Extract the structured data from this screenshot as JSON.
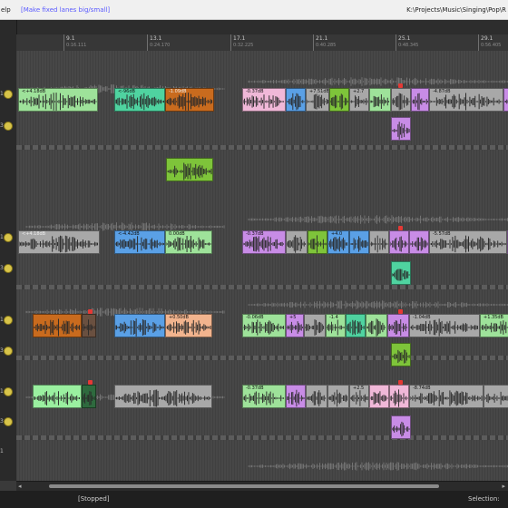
{
  "menubar": {
    "help": "elp",
    "hint": "[Make fixed lanes big/small]",
    "path": "K:\\Projects\\Music\\Singing\\Pop\\R"
  },
  "ruler": {
    "markers": [
      {
        "bar": "9.1",
        "time": "0:16.111"
      },
      {
        "bar": "13.1",
        "time": "0:24.170"
      },
      {
        "bar": "17.1",
        "time": "0:32.225"
      },
      {
        "bar": "21.1",
        "time": "0:40.285"
      },
      {
        "bar": "25.1",
        "time": "0:48.345"
      },
      {
        "bar": "29.1",
        "time": "0:56.405"
      }
    ]
  },
  "lanes": [
    {
      "num": "1",
      "has_dot": true
    },
    {
      "num": "3",
      "has_dot": true
    },
    {
      "num": "",
      "has_dot": false
    },
    {
      "num": "1",
      "has_dot": true
    },
    {
      "num": "3",
      "has_dot": true
    },
    {
      "num": "1",
      "has_dot": true
    },
    {
      "num": "3",
      "has_dot": true
    },
    {
      "num": "1",
      "has_dot": true
    },
    {
      "num": "3",
      "has_dot": true
    },
    {
      "num": "1",
      "has_dot": false
    }
  ],
  "clip_labels": {
    "a1": "<+4.18dB",
    "a2": "<-96dB",
    "a3": "-1.09dB",
    "a4": "-0.37dB",
    "a5": "+7.51dB",
    "a6": "+2.7",
    "a7": "-4.87dB",
    "b1": "<+4.18dB",
    "b2": "<-4.42dB",
    "b3": "0.00dB",
    "b4": "-0.37dB",
    "b5": "+4.0",
    "b6": "-5.57dB",
    "c1": "+0.50dB",
    "c2": "-0.06dB",
    "c3": "+5",
    "c4": "-1.4",
    "c5": "-1.04dB",
    "c6": "+1.35dB",
    "d1": "-0.37dB",
    "d2": "+2.5",
    "d3": "-8.74dB"
  },
  "status": {
    "state": "[Stopped]",
    "selection": "Selection:"
  },
  "colors": {
    "green": "#9ee29a",
    "teal": "#4fd3a0",
    "orange": "#c96b1e",
    "lime": "#7ec43a",
    "purple": "#c88ce6",
    "blue": "#5aa0e6",
    "pink": "#f0b8d8",
    "grey": "#a8a8a8"
  }
}
